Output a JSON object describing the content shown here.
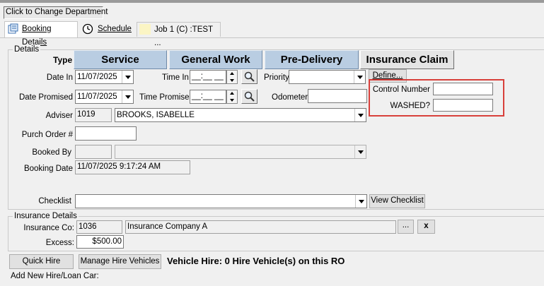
{
  "header": {
    "department_button": "Click to Change Department"
  },
  "page_tabs": [
    {
      "label": "Booking Details",
      "icon": "booking-icon"
    },
    {
      "label": "Schedule",
      "icon": "clock-icon"
    },
    {
      "label": "Job 1 (C) :TEST ...",
      "icon": "job-note-icon"
    }
  ],
  "details": {
    "group_title": "Details",
    "type_label": "Type",
    "type_tabs": [
      "Service",
      "General Work",
      "Pre-Delivery",
      "Insurance Claim"
    ],
    "active_type": "Insurance Claim",
    "date_in_label": "Date In",
    "date_in_value": "11/07/2025",
    "time_in_label": "Time In",
    "time_in_value": "__:__ __",
    "priority_label": "Priority",
    "priority_value": "",
    "define_button": "Define...",
    "date_promised_label": "Date Promised",
    "date_promised_value": "11/07/2025",
    "time_promised_label": "Time Promised",
    "time_promised_value": "__:__ __",
    "odometer_label": "Odometer:",
    "odometer_value": "",
    "control_number_label": "Control Number",
    "control_number_value": "",
    "washed_label": "WASHED?",
    "washed_value": "",
    "adviser_label": "Adviser",
    "adviser_code": "1019",
    "adviser_name": "BROOKS, ISABELLE",
    "purch_order_label": "Purch Order #",
    "purch_order_value": "",
    "booked_by_label": "Booked By",
    "booked_by_code": "",
    "booked_by_name": "",
    "booking_date_label": "Booking Date",
    "booking_date_value": "11/07/2025 9:17:24 AM",
    "checklist_label": "Checklist",
    "checklist_value": "",
    "view_checklist_button": "View Checklist"
  },
  "insurance": {
    "group_title": "Insurance Details",
    "company_label": "Insurance Co:",
    "company_code": "1036",
    "company_name": "Insurance Company A",
    "browse_button": "...",
    "clear_button": "x",
    "excess_label": "Excess:",
    "excess_value": "$500.00"
  },
  "hire": {
    "quick_hire_button": "Quick Hire",
    "manage_button": "Manage Hire Vehicles",
    "status_text": "Vehicle Hire: 0 Hire Vehicle(s) on this RO",
    "add_new_label": "Add New Hire/Loan Car:"
  },
  "colors": {
    "highlight_box": "#d8403b",
    "type_tab_bg": "#b9cde2"
  }
}
